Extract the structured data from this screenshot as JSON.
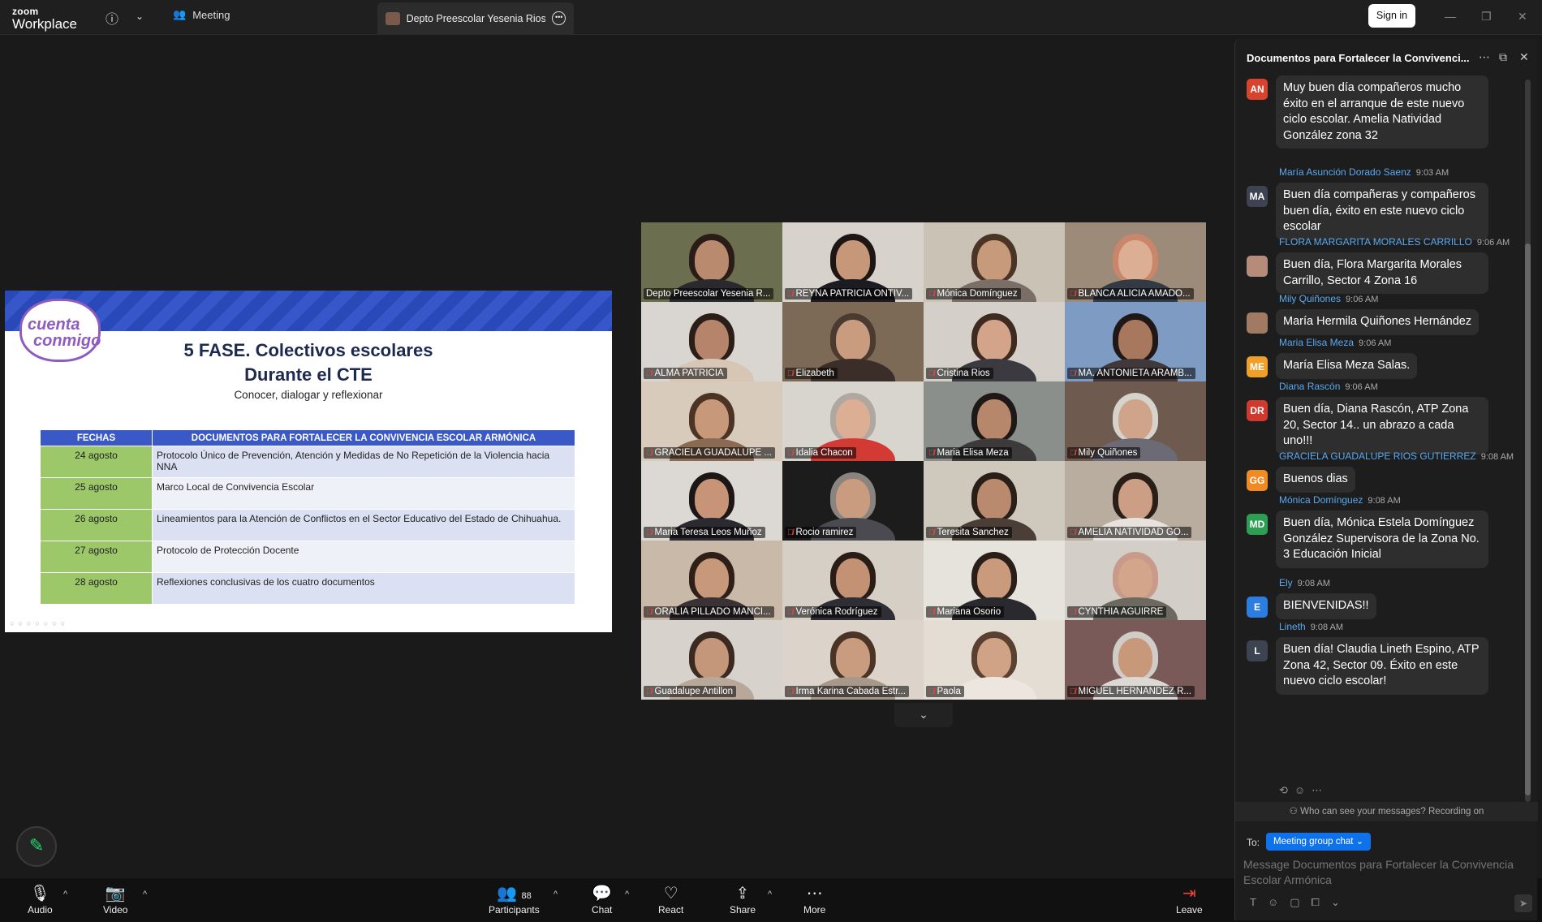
{
  "topbar": {
    "logo_small": "zoom",
    "logo_big": "Workplace",
    "meeting_label": "Meeting",
    "share_tab_label": "Depto Preescolar Yesenia Rios's sc",
    "signin_label": "Sign in"
  },
  "slide": {
    "logo_line1": "cuenta",
    "logo_line2": "conmigo",
    "title1": "5 FASE. Colectivos escolares",
    "title2": "Durante el CTE",
    "subtitle": "Conocer, dialogar y reflexionar",
    "col1": "FECHAS",
    "col2": "DOCUMENTOS PARA FORTALECER LA CONVIVENCIA ESCOLAR ARMÓNICA",
    "rows": [
      {
        "date": "24 agosto",
        "doc": "Protocolo Único de Prevención, Atención y Medidas de No Repetición de la Violencia hacia NNA"
      },
      {
        "date": "25 agosto",
        "doc": "Marco Local de Convivencia Escolar"
      },
      {
        "date": "26 agosto",
        "doc": "Lineamientos para la Atención de Conflictos en el Sector Educativo del Estado de Chihuahua."
      },
      {
        "date": "27 agosto",
        "doc": "Protocolo de Protección Docente"
      },
      {
        "date": "28 agosto",
        "doc": "Reflexiones conclusivas de los cuatro documentos"
      }
    ]
  },
  "gallery": {
    "participants": [
      {
        "name": "Depto Preescolar Yesenia R...",
        "bg": "#6b6e4f",
        "skin": "#b98a6e",
        "hair": "#2a1c16",
        "shirt": "#2a2a2e",
        "mic": false,
        "active": true
      },
      {
        "name": "REYNA PATRICIA ONTIV...",
        "bg": "#d8d2cc",
        "skin": "#c69779",
        "hair": "#1e1614",
        "shirt": "#1b1b22",
        "mic": true
      },
      {
        "name": "Mónica Domínguez",
        "bg": "#c9c2b5",
        "skin": "#c89a7c",
        "hair": "#4a3426",
        "shirt": "#7a6e66",
        "mic": true
      },
      {
        "name": "BLANCA ALICIA AMADO...",
        "bg": "#9c8b78",
        "skin": "#dcae94",
        "hair": "#c9866a",
        "shirt": "#343a44",
        "mic": true
      },
      {
        "name": "ALMA PATRICIA",
        "bg": "#d9d5d0",
        "skin": "#b5846a",
        "hair": "#2b1e18",
        "shirt": "#d8c6b4",
        "mic": true
      },
      {
        "name": "Elizabeth",
        "bg": "#7c6a56",
        "skin": "#c99c80",
        "hair": "#4a3a30",
        "shirt": "#3b2e28",
        "mic": true
      },
      {
        "name": "Cristina Rios",
        "bg": "#d4cfc9",
        "skin": "#d3a489",
        "hair": "#3d2a20",
        "shirt": "#3a3a40",
        "mic": true
      },
      {
        "name": "MA. ANTONIETA ARAMB...",
        "bg": "#7e9bc3",
        "skin": "#a8785e",
        "hair": "#201816",
        "shirt": "#40383a",
        "mic": true
      },
      {
        "name": "GRACIELA GUADALUPE ...",
        "bg": "#d8cbbc",
        "skin": "#c8987a",
        "hair": "#4c3424",
        "shirt": "#8a6a52",
        "mic": true
      },
      {
        "name": "Idalia Chacon",
        "bg": "#d8d4ce",
        "skin": "#dcae94",
        "hair": "#b0a8a0",
        "shirt": "#d43a34",
        "mic": true
      },
      {
        "name": "Maria Elisa Meza",
        "bg": "#8a8f8c",
        "skin": "#b7876c",
        "hair": "#1e1816",
        "shirt": "#3c3a3a",
        "mic": true
      },
      {
        "name": "Mily Quiñones",
        "bg": "#6e5a4e",
        "skin": "#d0a48a",
        "hair": "#d6d2cc",
        "shirt": "#6c6a74",
        "mic": true
      },
      {
        "name": "Maria Teresa Leos Muñoz",
        "bg": "#dcd8d4",
        "skin": "#c79478",
        "hair": "#1c1616",
        "shirt": "#2a2a30",
        "mic": true
      },
      {
        "name": "Rocio ramirez",
        "bg": "#1c1c1c",
        "skin": "#c99c80",
        "hair": "#8a8480",
        "shirt": "#4a4a50",
        "mic": true
      },
      {
        "name": "Teresita Sanchez",
        "bg": "#cfc8bd",
        "skin": "#b98a6e",
        "hair": "#2a1e18",
        "shirt": "#4a3e36",
        "mic": true
      },
      {
        "name": "AMELIA NATIVIDAD GO...",
        "bg": "#b9ada0",
        "skin": "#cc9f84",
        "hair": "#2a1e18",
        "shirt": "#e8e2dc",
        "mic": true
      },
      {
        "name": "ORALIA PILLADO MANCI...",
        "bg": "#c9b9a8",
        "skin": "#c8987a",
        "hair": "#2e2018",
        "shirt": "#3a3234",
        "mic": true
      },
      {
        "name": "Verónica Rodríguez",
        "bg": "#d6cfc6",
        "skin": "#c39274",
        "hair": "#2a1c16",
        "shirt": "#2e2e34",
        "mic": true
      },
      {
        "name": "Mariana Osorio",
        "bg": "#e6e2dc",
        "skin": "#c99a7c",
        "hair": "#2a1e18",
        "shirt": "#2a2a2e",
        "mic": true
      },
      {
        "name": "CYNTHIA AGUIRRE",
        "bg": "#d4cec8",
        "skin": "#d3a58a",
        "hair": "#c89a8a",
        "shirt": "#6c6a60",
        "mic": true
      },
      {
        "name": "Guadalupe Antillon",
        "bg": "#d8d2cc",
        "skin": "#c4967a",
        "hair": "#3a2a22",
        "shirt": "#b8a89a",
        "mic": true
      },
      {
        "name": "Irma Karina Cabada Estr...",
        "bg": "#dcd4ca",
        "skin": "#c99c80",
        "hair": "#4a3426",
        "shirt": "#a8988a",
        "mic": true
      },
      {
        "name": "Paola",
        "bg": "#e4ddd4",
        "skin": "#d0a286",
        "hair": "#5a4030",
        "shirt": "#ece6de",
        "mic": true
      },
      {
        "name": "MIGUEL HERNANDEZ R...",
        "bg": "#7a5a58",
        "skin": "#c8987a",
        "hair": "#d0ccc8",
        "shirt": "#dcd8d4",
        "mic": true
      }
    ]
  },
  "bottombar": {
    "audio": "Audio",
    "video": "Video",
    "participants": "Participants",
    "participants_count": "88",
    "chat": "Chat",
    "react": "React",
    "share": "Share",
    "more": "More",
    "leave": "Leave"
  },
  "chat": {
    "title": "Documentos para Fortalecer la Convivenci...",
    "messages": [
      {
        "avatar": "AN",
        "avatar_color": "#d8432e",
        "sender": "",
        "time": "",
        "text": "Muy buen día compañeros  mucho éxito en el arranque de este nuevo ciclo escolar. Amelia Natividad González zona 32"
      },
      {
        "avatar": "MA",
        "avatar_color": "#3d4350",
        "sender": "María Asunción Dorado Saenz",
        "time": "9:03 AM",
        "text": "Buen día compañeras y compañeros buen día, éxito en este nuevo ciclo escolar"
      },
      {
        "avatar": "",
        "avatar_color": "#b78b7a",
        "sender": "FLORA MARGARITA MORALES CARRILLO",
        "time": "9:06 AM",
        "text": "Buen día, Flora Margarita Morales Carrillo, Sector 4 Zona 16"
      },
      {
        "avatar": "",
        "avatar_color": "#a07a62",
        "sender": "Mily Quiñones",
        "time": "9:06 AM",
        "text": "María Hermila Quiñones Hernández"
      },
      {
        "avatar": "ME",
        "avatar_color": "#f0a02a",
        "sender": "Maria Elisa Meza",
        "time": "9:06 AM",
        "text": "María Elisa Meza Salas."
      },
      {
        "avatar": "DR",
        "avatar_color": "#d0392e",
        "sender": "Diana Rascón",
        "time": "9:06 AM",
        "text": "Buen día, Diana Rascón, ATP Zona 20, Sector 14.. un abrazo a cada uno!!!"
      },
      {
        "avatar": "GG",
        "avatar_color": "#f08a22",
        "sender": "GRACIELA GUADALUPE RIOS GUTIERREZ",
        "time": "9:08 AM",
        "text": "Buenos dias"
      },
      {
        "avatar": "MD",
        "avatar_color": "#2e9e55",
        "sender": "Mónica Domínguez",
        "time": "9:08 AM",
        "text": "Buen día, Mónica Estela Domínguez González Supervisora de la Zona No. 3 Educación Inicial"
      },
      {
        "avatar": "E",
        "avatar_color": "#2b7de0",
        "sender": "Ely",
        "time": "9:08 AM",
        "text": "BIENVENIDAS!!"
      },
      {
        "avatar": "L",
        "avatar_color": "#3d4350",
        "sender": "Lineth",
        "time": "9:08 AM",
        "text": "Buen día! Claudia Lineth Espino, ATP Zona 42, Sector 09. Éxito en este nuevo ciclo escolar!"
      }
    ],
    "who_can_see": "Who can see your messages? Recording on",
    "to_label": "To:",
    "to_target": "Meeting group chat",
    "input_placeholder": "Message Documentos para Fortalecer la Convivencia Escolar Armónica"
  }
}
